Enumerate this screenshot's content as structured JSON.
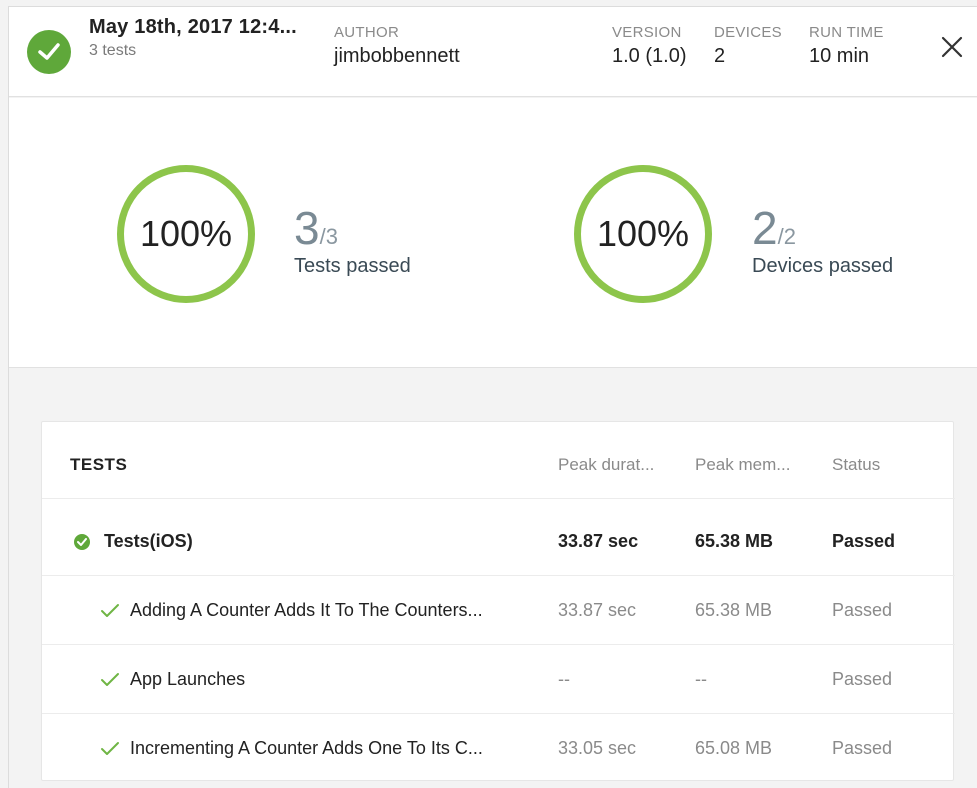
{
  "header": {
    "title": "May 18th, 2017 12:4...",
    "subtitle": "3 tests",
    "author_label": "AUTHOR",
    "author_value": "jimbobbennett",
    "version_label": "VERSION",
    "version_value": "1.0 (1.0)",
    "devices_label": "DEVICES",
    "devices_value": "2",
    "runtime_label": "RUN TIME",
    "runtime_value": "10 min",
    "status_icon": "check-circle-icon",
    "close_icon": "close-icon"
  },
  "summary": {
    "tests": {
      "percent": "100%",
      "passed": "3",
      "total": "/3",
      "label": "Tests passed"
    },
    "devices": {
      "percent": "100%",
      "passed": "2",
      "total": "/2",
      "label": "Devices passed"
    },
    "ring_color": "#8dc54b"
  },
  "tests_table": {
    "heading": "TESTS",
    "columns": [
      "Peak durat...",
      "Peak mem...",
      "Status"
    ],
    "group": {
      "name": "Tests(iOS)",
      "duration": "33.87 sec",
      "memory": "65.38 MB",
      "status": "Passed"
    },
    "rows": [
      {
        "name": "Adding A Counter Adds It To The Counters...",
        "duration": "33.87 sec",
        "memory": "65.38 MB",
        "status": "Passed"
      },
      {
        "name": "App Launches",
        "duration": "--",
        "memory": "--",
        "status": "Passed"
      },
      {
        "name": "Incrementing A Counter Adds One To Its C...",
        "duration": "33.05 sec",
        "memory": "65.08 MB",
        "status": "Passed"
      }
    ]
  },
  "colors": {
    "success": "#5fa83a",
    "check": "#6fb544"
  }
}
